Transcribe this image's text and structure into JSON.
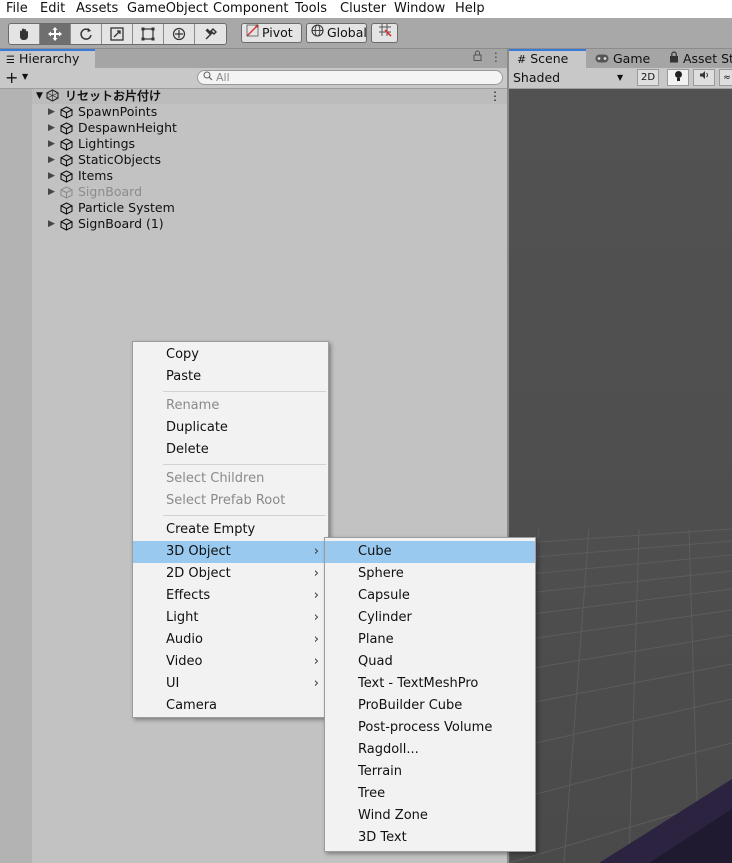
{
  "menubar": {
    "items": [
      "File",
      "Edit",
      "Assets",
      "GameObject",
      "Component",
      "Tools",
      "Cluster",
      "Window",
      "Help"
    ]
  },
  "toolbar": {
    "tools": [
      "hand-tool-icon",
      "move-tool-icon",
      "rotate-tool-icon",
      "scale-tool-icon",
      "rect-tool-icon",
      "transform-tool-icon",
      "custom-tool-icon"
    ],
    "active_tool": "move-tool-icon",
    "pivot_label": "Pivot",
    "global_label": "Global"
  },
  "hierarchy": {
    "tab_label": "Hierarchy",
    "search_placeholder": "All",
    "scene_name": "リセットお片付け",
    "items": [
      {
        "label": "SpawnPoints",
        "has_children": true,
        "active": true
      },
      {
        "label": "DespawnHeight",
        "has_children": true,
        "active": true
      },
      {
        "label": "Lightings",
        "has_children": true,
        "active": true
      },
      {
        "label": "StaticObjects",
        "has_children": true,
        "active": true
      },
      {
        "label": "Items",
        "has_children": true,
        "active": true
      },
      {
        "label": "SignBoard",
        "has_children": true,
        "active": false
      },
      {
        "label": "Particle System",
        "has_children": false,
        "active": true
      },
      {
        "label": "SignBoard (1)",
        "has_children": true,
        "active": true
      }
    ]
  },
  "scene_panel": {
    "tabs": [
      {
        "label": "Scene",
        "icon": "hash-icon",
        "active": true
      },
      {
        "label": "Game",
        "icon": "gamepad-icon",
        "active": false
      },
      {
        "label": "Asset St",
        "icon": "lock-icon",
        "active": false
      }
    ],
    "shading_mode": "Shaded",
    "mode_2d": "2D"
  },
  "context_menu": {
    "items": [
      {
        "label": "Copy",
        "enabled": true
      },
      {
        "label": "Paste",
        "enabled": true
      },
      {
        "separator": true
      },
      {
        "label": "Rename",
        "enabled": false
      },
      {
        "label": "Duplicate",
        "enabled": true
      },
      {
        "label": "Delete",
        "enabled": true
      },
      {
        "separator": true
      },
      {
        "label": "Select Children",
        "enabled": false
      },
      {
        "label": "Select Prefab Root",
        "enabled": false
      },
      {
        "separator": true
      },
      {
        "label": "Create Empty",
        "enabled": true
      },
      {
        "label": "3D Object",
        "enabled": true,
        "submenu": true,
        "highlighted": true
      },
      {
        "label": "2D Object",
        "enabled": true,
        "submenu": true
      },
      {
        "label": "Effects",
        "enabled": true,
        "submenu": true
      },
      {
        "label": "Light",
        "enabled": true,
        "submenu": true
      },
      {
        "label": "Audio",
        "enabled": true,
        "submenu": true
      },
      {
        "label": "Video",
        "enabled": true,
        "submenu": true
      },
      {
        "label": "UI",
        "enabled": true,
        "submenu": true
      },
      {
        "label": "Camera",
        "enabled": true
      }
    ]
  },
  "submenu_3d_object": {
    "items": [
      {
        "label": "Cube",
        "highlighted": true
      },
      {
        "label": "Sphere"
      },
      {
        "label": "Capsule"
      },
      {
        "label": "Cylinder"
      },
      {
        "label": "Plane"
      },
      {
        "label": "Quad"
      },
      {
        "label": "Text - TextMeshPro"
      },
      {
        "label": "ProBuilder Cube"
      },
      {
        "label": "Post-process Volume"
      },
      {
        "label": "Ragdoll..."
      },
      {
        "label": "Terrain"
      },
      {
        "label": "Tree"
      },
      {
        "label": "Wind Zone"
      },
      {
        "label": "3D Text"
      }
    ]
  },
  "colors": {
    "menu_highlight": "#99c9ef",
    "tab_accent": "#3a79d8",
    "editor_bg": "#c2c2c2",
    "scene_bg": "#4e4e4e"
  }
}
